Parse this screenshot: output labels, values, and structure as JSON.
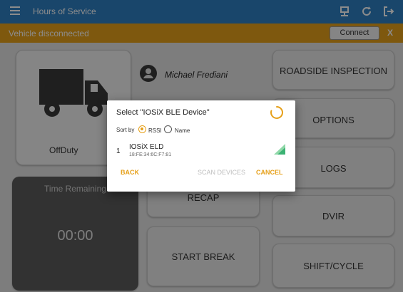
{
  "appbar": {
    "title": "Hours of Service",
    "icons": [
      "menu-icon",
      "device-icon",
      "refresh-icon",
      "logout-icon"
    ]
  },
  "banner": {
    "message": "Vehicle disconnected",
    "connect_label": "Connect",
    "close_label": "X"
  },
  "status": {
    "duty_status": "OffDuty"
  },
  "driver": {
    "name": "Michael Frediani"
  },
  "timer": {
    "label": "Time Remaining",
    "value": "00:00"
  },
  "actions": {
    "roadside": "ROADSIDE INSPECTION",
    "options": "OPTIONS",
    "logs": "LOGS",
    "dvir": "DVIR",
    "shift": "SHIFT/CYCLE",
    "recap": "RECAP",
    "start_break": "START BREAK"
  },
  "dialog": {
    "title": "Select \"IOSiX BLE Device\"",
    "sort_label": "Sort by",
    "sort_options": [
      {
        "label": "RSSI",
        "selected": true
      },
      {
        "label": "Name",
        "selected": false
      }
    ],
    "device": {
      "index": "1",
      "name": "IOSiX ELD",
      "mac": "18:FE:34:6C:F7:81"
    },
    "back_label": "BACK",
    "scan_label": "SCAN DEVICES",
    "cancel_label": "CANCEL"
  },
  "colors": {
    "appbar": "#2f80c4",
    "banner": "#e6a01a",
    "accent": "#e6a01a",
    "signal": "#3bb273",
    "disabled": "#bdbdbd"
  }
}
